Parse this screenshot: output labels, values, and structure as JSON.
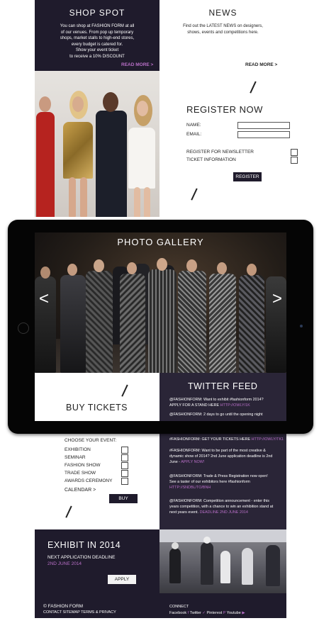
{
  "shop_spot": {
    "title": "SHOP SPOT",
    "lines": [
      "You can shop at FASHION FORM at all",
      "of our venues. From pop up temporary",
      "shops, market stalls to high-end stores,",
      "every budget is catered for.",
      "Show your event ticket",
      "to receive a 10% DISCOUNT"
    ],
    "read_more": "READ MORE >"
  },
  "news": {
    "title": "NEWS",
    "lines": [
      "Find out the LATEST NEWS on designers,",
      "shows, events and competitions here."
    ],
    "read_more": "READ MORE >"
  },
  "register": {
    "title": "REGISTER NOW",
    "name_label": "NAME:",
    "email_label": "EMAIL:",
    "newsletter_label": "REGISTER FOR NEWSLETTER",
    "ticket_label": "TICKET INFORMATION",
    "button": "REGISTER"
  },
  "gallery": {
    "title": "PHOTO GALLERY",
    "prev": "<",
    "next": ">"
  },
  "tickets": {
    "title": "BUY TICKETS",
    "choose_label": "CHOOSE YOUR EVENT:",
    "events": [
      "EXHIBITION",
      "SEMINAR",
      "FASHION SHOW",
      "TRADE SHOW",
      "AWARDS CEREMONY"
    ],
    "calendar": "CALENDAR >",
    "buy_button": "BUY"
  },
  "twitter": {
    "title": "TWITTER FEED",
    "tablet_feed": {
      "p1": "@FASHIONFORM: Want to exhibit #fashionform 2014?",
      "p2": "APPLY FOR A STAND HERE",
      "p2_link": "HTTP://OWLY/1K",
      "p3": "@FASHIONFORM: 2 days to go until the opening night"
    },
    "page_feed": {
      "t1": "#FASHIONFORM: GET YOUR TICKETS HERE",
      "t1_link": "HTTP://OWLY/TK1",
      "t2a": "#FASHIONFORM: Want to be part of the most creative &",
      "t2b": "dynamic show of 2014? 2nd June application deadline is 2nd",
      "t2c": "June -",
      "t2_link": "APPLY NOW!",
      "t3a": "@FASHIONFORM: Trade & Press Registration now open!",
      "t3b": "See a taster of our exhibitors here #fashionform",
      "t3_link": "HTTP://SNDBL/TO/BNH",
      "t4a": "@FASHIONFORM: Competition announcement - enter this",
      "t4b": "years competition, with a chance to win an exhibition stand at",
      "t4c": "next years event.",
      "t4_link": "DEADLINE 2ND JUNE 2014"
    }
  },
  "exhibit": {
    "title": "EXHIBIT IN 2014",
    "deadline_label": "NEXT APPLICATION DEADLINE",
    "deadline_date": "2ND JUNE 2014",
    "apply_button": "APPLY"
  },
  "footer": {
    "brand": "© FASHION FORM",
    "links": "CONTACT  SITEMAP  TERMS & PRIVACY",
    "connect": "CONNECT",
    "facebook": "Facebook",
    "twitter": "Twitter",
    "pinterest": "Pinterest",
    "youtube": "Youtube"
  },
  "colors": {
    "navy": "#1f1b2c",
    "accent": "#b86fc7"
  }
}
